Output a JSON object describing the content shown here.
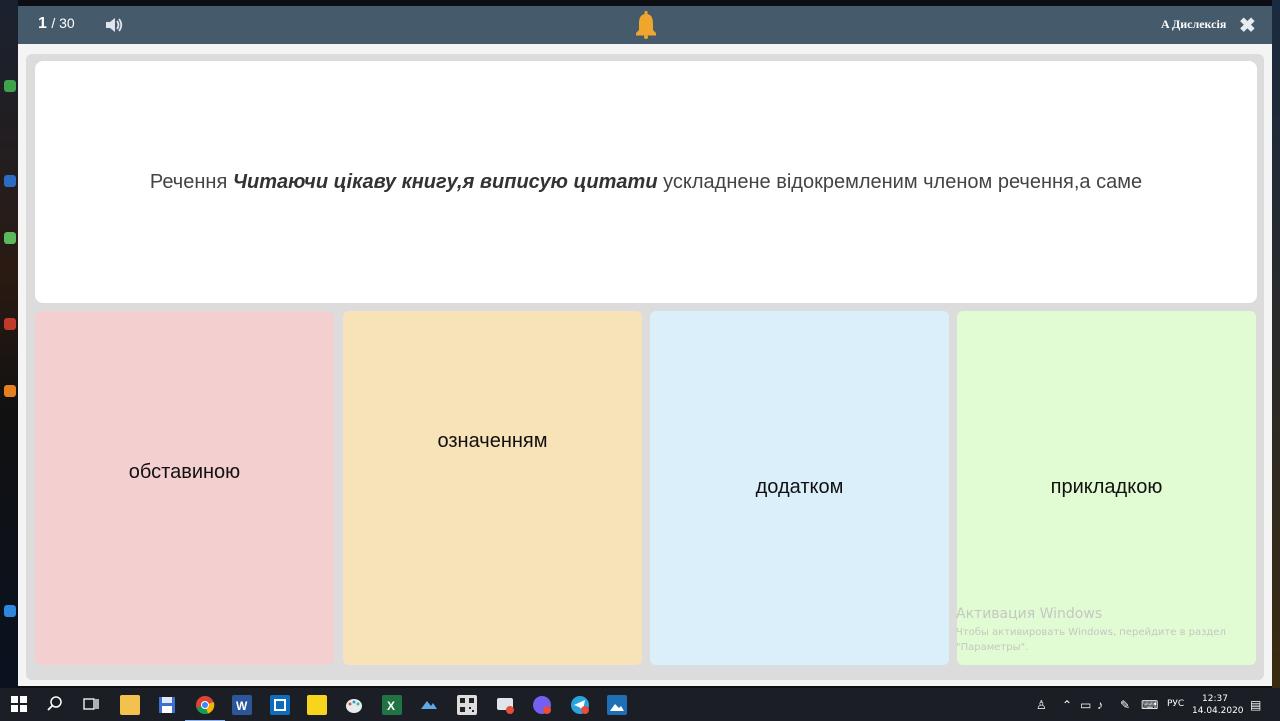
{
  "header": {
    "current": "1",
    "total": "/ 30",
    "dyslexia_label": "A Дислексія",
    "close_glyph": "✖",
    "accent_color": "#455a6b"
  },
  "question": {
    "prefix": "Речення ",
    "emphasis": "Читаючи цікаву книгу,я виписую цитати",
    "suffix": " ускладнене відокремленим членом речення,а саме"
  },
  "answers": [
    {
      "label": "обставиною",
      "color": "#f3cfcf"
    },
    {
      "label": "означенням",
      "color": "#f8e2b7"
    },
    {
      "label": "додатком",
      "color": "#dbeffb"
    },
    {
      "label": "прикладкою",
      "color": "#e1fbd3"
    }
  ],
  "watermark": {
    "title": "Активация Windows",
    "line1": "Чтобы активировать Windows, перейдите в раздел",
    "line2": "\"Параметры\"."
  },
  "taskbar": {
    "lang": "РУС",
    "time": "12:37",
    "date": "14.04.2020",
    "icons": [
      "windows-start-icon",
      "search-icon",
      "task-view-icon",
      "file-explorer-icon",
      "save-icon",
      "chrome-icon",
      "word-icon",
      "outlook-icon",
      "sticky-notes-icon",
      "paint-icon",
      "excel-icon",
      "photos-icon",
      "qr-icon",
      "screen-recorder-icon",
      "viber-icon",
      "telegram-icon",
      "image-viewer-icon"
    ]
  }
}
